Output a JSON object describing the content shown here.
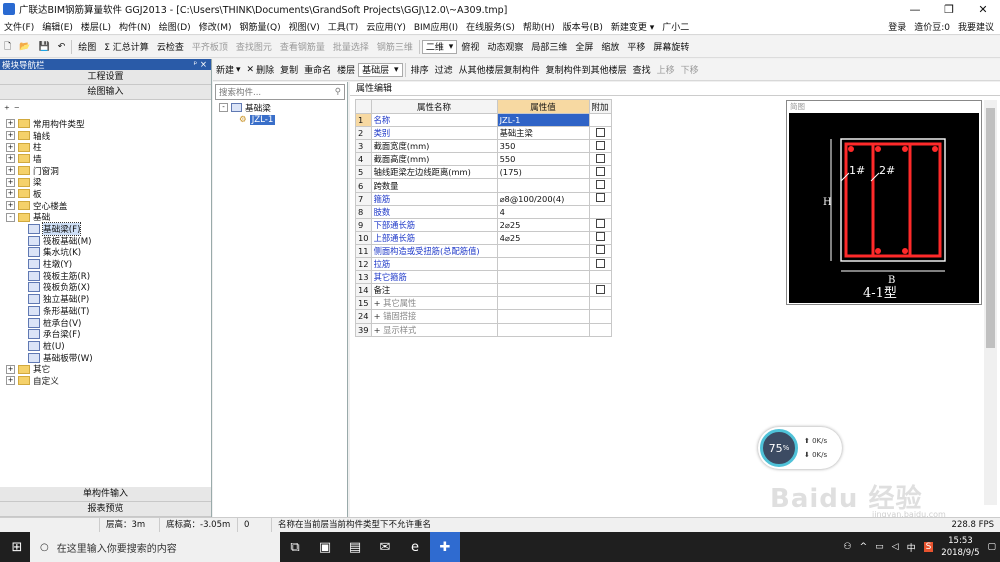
{
  "window": {
    "title": "广联达BIM钢筋算量软件 GGJ2013 - [C:\\Users\\THINK\\Documents\\GrandSoft Projects\\GGJ\\12.0\\~A309.tmp]"
  },
  "menu": {
    "items": [
      "文件(F)",
      "编辑(E)",
      "楼层(L)",
      "构件(N)",
      "绘图(D)",
      "修改(M)",
      "钢筋量(Q)",
      "视图(V)",
      "工具(T)",
      "云应用(Y)",
      "BIM应用(I)",
      "在线服务(S)",
      "帮助(H)",
      "版本号(B)",
      "新建变更 ▾",
      "广小二"
    ],
    "right": {
      "login": "登录",
      "beans": "造价豆:0",
      "suggest": "我要建议"
    }
  },
  "toolbar1": {
    "items": [
      "绘图",
      "Σ 汇总计算",
      "云检查",
      "平齐板顶",
      "查找图元",
      "查看钢筋量",
      "批量选择",
      "钢筋三维"
    ],
    "view_select": "二维",
    "right_items": [
      "俯视",
      "动态观察",
      "局部三维",
      "全屏",
      "缩放",
      "平移",
      "屏幕旋转"
    ]
  },
  "toolbar2": {
    "items": [
      "新建",
      "删除",
      "复制",
      "重命名"
    ],
    "floor_label": "楼层",
    "floor_value": "基础层",
    "sort": "排序",
    "filter": "过滤",
    "copy_from": "从其他楼层复制构件",
    "copy_to": "复制构件到其他楼层",
    "find": "查找",
    "up": "上移",
    "down": "下移"
  },
  "left_panel": {
    "header": "模块导航栏",
    "pin": "ᵖ ×",
    "btn_project": "工程设置",
    "btn_draw": "绘图输入",
    "tree": [
      {
        "label": "常用构件类型",
        "level": 0,
        "toggle": "+"
      },
      {
        "label": "轴线",
        "level": 0,
        "toggle": "+"
      },
      {
        "label": "柱",
        "level": 0,
        "toggle": "+"
      },
      {
        "label": "墙",
        "level": 0,
        "toggle": "+"
      },
      {
        "label": "门窗洞",
        "level": 0,
        "toggle": "+"
      },
      {
        "label": "梁",
        "level": 0,
        "toggle": "+"
      },
      {
        "label": "板",
        "level": 0,
        "toggle": "+"
      },
      {
        "label": "空心楼盖",
        "level": 0,
        "toggle": "+"
      },
      {
        "label": "基础",
        "level": 0,
        "toggle": "-"
      },
      {
        "label": "基础梁(F)",
        "level": 1,
        "selected": true
      },
      {
        "label": "筏板基础(M)",
        "level": 1
      },
      {
        "label": "集水坑(K)",
        "level": 1
      },
      {
        "label": "柱墩(Y)",
        "level": 1
      },
      {
        "label": "筏板主筋(R)",
        "level": 1
      },
      {
        "label": "筏板负筋(X)",
        "level": 1
      },
      {
        "label": "独立基础(P)",
        "level": 1
      },
      {
        "label": "条形基础(T)",
        "level": 1
      },
      {
        "label": "桩承台(V)",
        "level": 1
      },
      {
        "label": "承台梁(F)",
        "level": 1
      },
      {
        "label": "桩(U)",
        "level": 1
      },
      {
        "label": "基础板带(W)",
        "level": 1
      },
      {
        "label": "其它",
        "level": 0,
        "toggle": "+"
      },
      {
        "label": "自定义",
        "level": 0,
        "toggle": "+"
      }
    ],
    "btn_single": "单构件输入",
    "btn_report": "报表预览"
  },
  "mid_panel": {
    "search_placeholder": "搜索构件...",
    "tree_root": "基础梁",
    "tree_item": "JZL-1"
  },
  "props": {
    "tab": "属性编辑",
    "headers": {
      "name": "属性名称",
      "value": "属性值",
      "extra": "附加"
    },
    "rows": [
      {
        "n": "1",
        "k": "名称",
        "v": "JZL-1",
        "blue": true,
        "cb": false
      },
      {
        "n": "2",
        "k": "类别",
        "v": "基础主梁",
        "blue": true,
        "cb": true
      },
      {
        "n": "3",
        "k": "截面宽度(mm)",
        "v": "350",
        "blue": false,
        "cb": true
      },
      {
        "n": "4",
        "k": "截面高度(mm)",
        "v": "550",
        "blue": false,
        "cb": true
      },
      {
        "n": "5",
        "k": "轴线距梁左边线距离(mm)",
        "v": "(175)",
        "blue": false,
        "cb": true
      },
      {
        "n": "6",
        "k": "跨数量",
        "v": "",
        "blue": false,
        "cb": true
      },
      {
        "n": "7",
        "k": "箍筋",
        "v": "⌀8@100/200(4)",
        "blue": true,
        "cb": true
      },
      {
        "n": "8",
        "k": "肢数",
        "v": "4",
        "blue": true,
        "cb": false
      },
      {
        "n": "9",
        "k": "下部通长筋",
        "v": "2⌀25",
        "blue": true,
        "cb": true
      },
      {
        "n": "10",
        "k": "上部通长筋",
        "v": "4⌀25",
        "blue": true,
        "cb": true
      },
      {
        "n": "11",
        "k": "侧面构造或受扭筋(总配筋值)",
        "v": "",
        "blue": true,
        "cb": true
      },
      {
        "n": "12",
        "k": "拉筋",
        "v": "",
        "blue": true,
        "cb": true
      },
      {
        "n": "13",
        "k": "其它箍筋",
        "v": "",
        "blue": true,
        "cb": false
      },
      {
        "n": "14",
        "k": "备注",
        "v": "",
        "blue": false,
        "cb": true
      },
      {
        "n": "15",
        "k": "其它属性",
        "v": "",
        "group": true
      },
      {
        "n": "24",
        "k": "锚固搭接",
        "v": "",
        "group": true
      },
      {
        "n": "39",
        "k": "显示样式",
        "v": "",
        "group": true
      }
    ]
  },
  "preview": {
    "title": "简图",
    "label_h": "H",
    "label_b": "B",
    "type_label": "4-1型",
    "bar1": "1#",
    "bar2": "2#"
  },
  "status": {
    "floor_height": "层高：3m",
    "floor_bottom": "底标高：-3.05m",
    "zero": "0",
    "message": "名称在当前层当前构件类型下不允许重名",
    "fps": "228.8 FPS"
  },
  "network": {
    "percent": "75",
    "unit": "%",
    "up": "0K/s",
    "down": "0K/s"
  },
  "taskbar": {
    "search": "在这里输入你要搜索的内容",
    "time": "15:53",
    "date": "2018/9/5",
    "ime": "中"
  },
  "watermark": {
    "text": "Baidu 经验",
    "url": "jingyan.baidu.com"
  },
  "colors": {
    "accent": "#2a5ba8",
    "value_header": "#f7d9a2",
    "rebar": "#ff2a2a",
    "preview_bg": "#000000"
  }
}
